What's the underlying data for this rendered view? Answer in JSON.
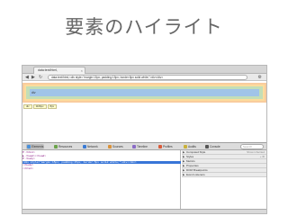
{
  "slide": {
    "title": "要素のハイライト"
  },
  "browser": {
    "tab_title": "data:text/html,",
    "url": "data:text/html,<div style=\"margin:15px; padding:15px; border:5px solid white;\">div</div>",
    "page": {
      "content_text": "div",
      "tooltip": [
        "div",
        "1106px",
        "8px"
      ]
    }
  },
  "devtools": {
    "tabs": [
      {
        "label": "Elements",
        "color": "#4a90d9"
      },
      {
        "label": "Resources",
        "color": "#6ba34a"
      },
      {
        "label": "Network",
        "color": "#3a7bd5"
      },
      {
        "label": "Sources",
        "color": "#d9923a"
      },
      {
        "label": "Timeline",
        "color": "#8a6bc6"
      },
      {
        "label": "Profiles",
        "color": "#d95b3a"
      },
      {
        "label": "Audits",
        "color": "#c9b13a"
      },
      {
        "label": "Console",
        "color": "#555555"
      }
    ],
    "search_placeholder": "Search Elements",
    "dom_lines": [
      "▼ <html>",
      "  ▶ <head></head>",
      "  ▼ <body>",
      "      <div style=\"margin:15px; padding:15px; border:5px solid white;\">div</div>",
      "    </body>",
      "  </html>"
    ],
    "side_panels": [
      {
        "label": "Computed Style",
        "extra": "Show inherited"
      },
      {
        "label": "Styles",
        "extra": "+ ⚙"
      },
      {
        "label": "Metrics",
        "extra": ""
      },
      {
        "label": "Properties",
        "extra": ""
      },
      {
        "label": "DOM Breakpoints",
        "extra": ""
      },
      {
        "label": "Event Listeners",
        "extra": ""
      }
    ]
  },
  "colors": {
    "margin": "#f9cc9d",
    "border": "#fcdc9c",
    "padding": "#c3deb7",
    "content": "#a0c4e8",
    "selection": "#3875d7"
  }
}
